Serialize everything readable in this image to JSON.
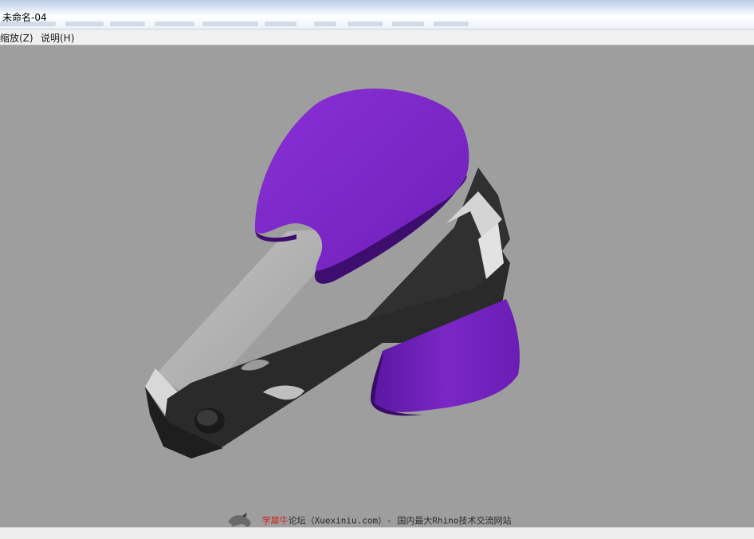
{
  "window": {
    "title": "未命名-04"
  },
  "menu": {
    "items": [
      "缩放(Z)",
      "说明(H)"
    ]
  },
  "viewport": {
    "background": "#9e9e9e",
    "model_colors": {
      "handle_purple": "#7a26c8",
      "body_dark": "#2b2b2b",
      "plate_light": "#b4b4b4"
    }
  },
  "watermark": {
    "brand": "学犀牛",
    "text": "论坛（Xuexiniu.com）- 国内最大Rhino技术交流网站"
  }
}
